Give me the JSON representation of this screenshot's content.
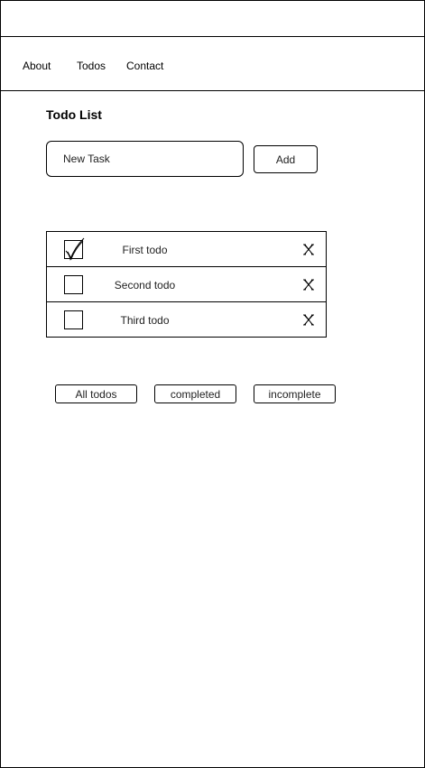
{
  "nav": {
    "items": [
      {
        "label": "About"
      },
      {
        "label": "Todos"
      },
      {
        "label": "Contact"
      }
    ]
  },
  "page": {
    "title": "Todo List"
  },
  "new_task": {
    "placeholder": "New Task",
    "value": ""
  },
  "add_button": {
    "label": "Add"
  },
  "todos": [
    {
      "label": "First todo",
      "checked": true,
      "delete_icon": "x-delete-icon"
    },
    {
      "label": "Second todo",
      "checked": false,
      "delete_icon": "x-delete-icon"
    },
    {
      "label": "Third todo",
      "checked": false,
      "delete_icon": "x-delete-icon"
    }
  ],
  "filters": [
    {
      "label": "All todos"
    },
    {
      "label": "completed"
    },
    {
      "label": "incomplete"
    }
  ],
  "colors": {
    "border": "#000000",
    "background": "#ffffff",
    "text": "#222222"
  }
}
